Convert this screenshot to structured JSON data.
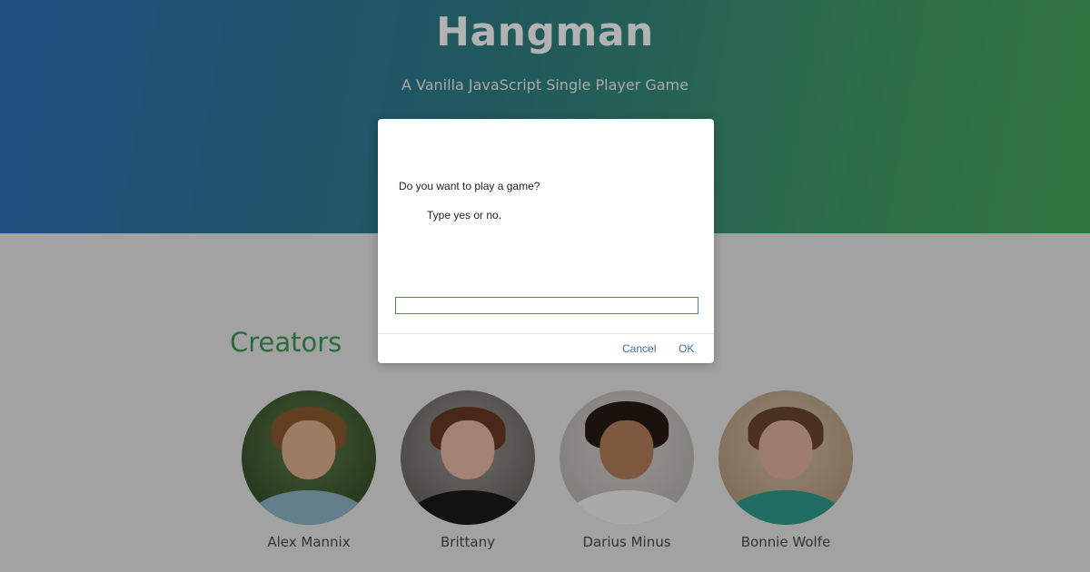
{
  "header": {
    "title": "Hangman",
    "subtitle": "A Vanilla JavaScript Single Player Game"
  },
  "creators": {
    "heading": "Creators",
    "people": [
      {
        "name": "Alex Mannix"
      },
      {
        "name": "Brittany"
      },
      {
        "name": "Darius Minus"
      },
      {
        "name": "Bonnie Wolfe"
      }
    ]
  },
  "dialog": {
    "message": "Do you want to play a game?",
    "detail": "Type yes or no.",
    "input_value": "",
    "cancel_label": "Cancel",
    "ok_label": "OK"
  },
  "colors": {
    "accent_green": "#3a9a55",
    "dialog_button_blue": "#3b6fb5"
  }
}
